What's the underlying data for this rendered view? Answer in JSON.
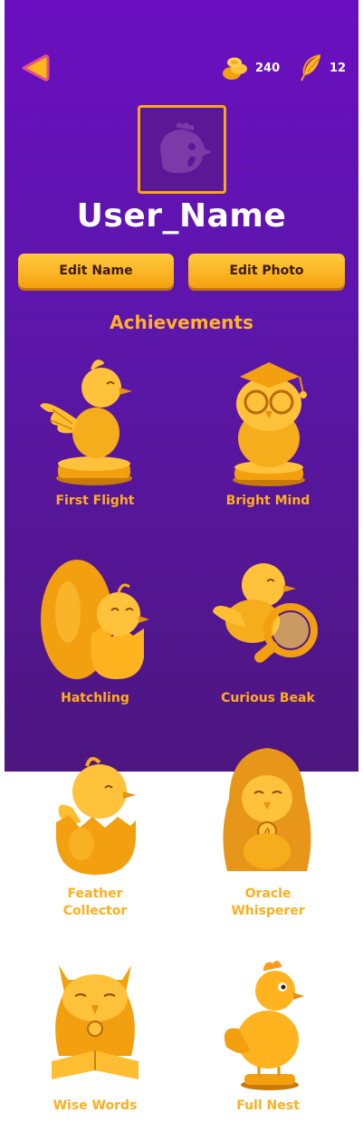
{
  "header": {
    "coins": "240",
    "feathers": "12"
  },
  "profile": {
    "username": "User_Name",
    "edit_name_label": "Edit Name",
    "edit_photo_label": "Edit Photo"
  },
  "achievements": {
    "title": "Achievements",
    "items": [
      {
        "label": "First Flight",
        "icon": "chick-flapping-trophy-icon"
      },
      {
        "label": "Bright Mind",
        "icon": "owl-graduate-trophy-icon"
      },
      {
        "label": "Hatchling",
        "icon": "chick-hatching-egg-icon"
      },
      {
        "label": "Curious Beak",
        "icon": "chick-magnifier-icon"
      },
      {
        "label": "Feather\nCollector",
        "icon": "chick-in-shell-icon"
      },
      {
        "label": "Oracle\nWhisperer",
        "icon": "hooded-bird-icon"
      },
      {
        "label": "Wise Words",
        "icon": "owl-reading-book-icon"
      },
      {
        "label": "Full Nest",
        "icon": "hen-trophy-icon"
      }
    ]
  },
  "colors": {
    "panel_top": "#6a0fc0",
    "panel_bottom": "#4d1680",
    "gold": "#ffae1f",
    "button": "#f6a20f"
  }
}
